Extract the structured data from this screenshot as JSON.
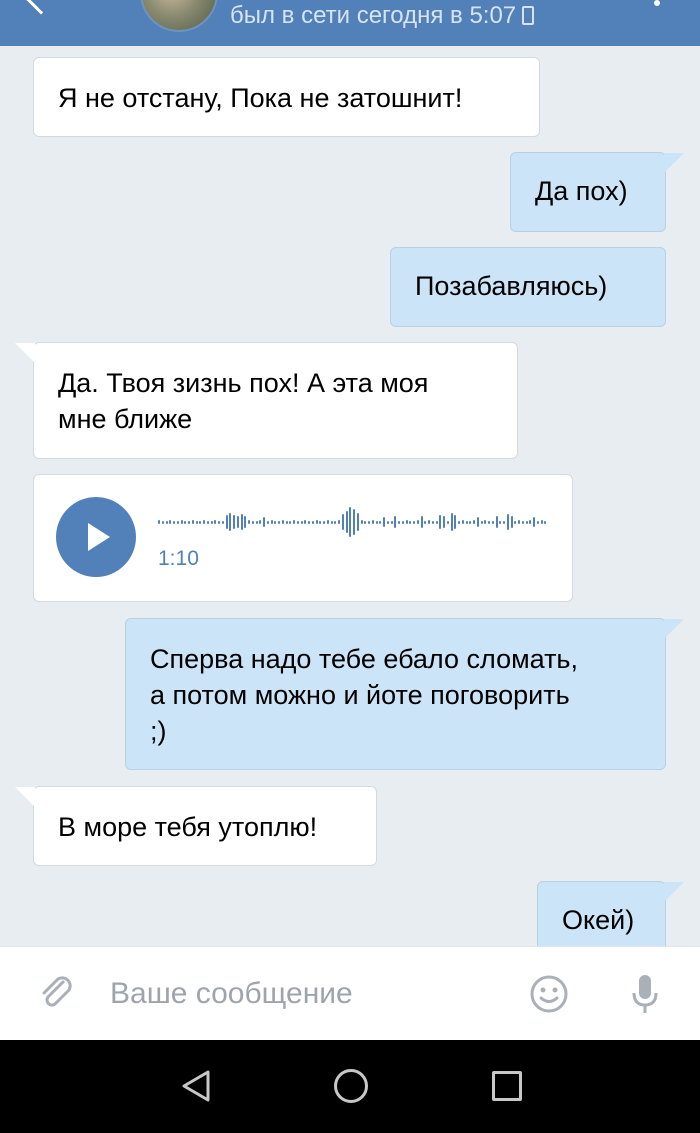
{
  "header": {
    "status": "был в сети сегодня в 5:07",
    "icons": [
      "back-icon",
      "avatar",
      "phone-icon",
      "menu-icon"
    ]
  },
  "messages": [
    {
      "direction": "in",
      "text": "Я не отстану, Пока не затошнит!"
    },
    {
      "direction": "out",
      "text": "Да пох)"
    },
    {
      "direction": "out",
      "text": "Позабавляюсь)"
    },
    {
      "direction": "in",
      "lines": [
        "Да. Твоя зизнь пох! А эта моя",
        "мне ближе"
      ]
    },
    {
      "direction": "in",
      "type": "voice",
      "duration": "1:10"
    },
    {
      "direction": "out",
      "lines": [
        "Сперва надо тебе ебало сломать,",
        "а потом можно и йоте поговорить",
        ";)"
      ]
    },
    {
      "direction": "in",
      "text": "В море тебя утоплю!"
    },
    {
      "direction": "out",
      "text": "Окей)"
    }
  ],
  "input": {
    "placeholder": "Ваше сообщение"
  },
  "navbar": {
    "icons": [
      "nav-back-icon",
      "nav-home-icon",
      "nav-recents-icon"
    ]
  },
  "colors": {
    "header": "#5181b8",
    "background": "#e8edf2",
    "incoming_bubble": "#ffffff",
    "outgoing_bubble": "#cce4f7",
    "accent": "#5181b8"
  }
}
